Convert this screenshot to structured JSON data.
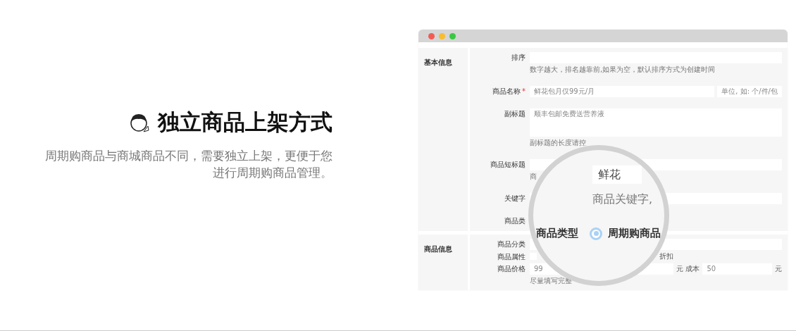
{
  "headline": {
    "title": "独立商品上架方式",
    "description_lines": [
      "周期购商品与商城商品不同，需要独立上架，更便于您",
      "进行周期购商品管理。"
    ]
  },
  "form": {
    "sections": [
      {
        "title": "基本信息",
        "rows": [
          {
            "kind": "input",
            "label": "排序",
            "hint": "数字越大，排名越靠前,如果为空，默认排序方式为创建时间"
          },
          {
            "kind": "input",
            "label": "商品名称",
            "required_mark": "*",
            "placeholder": "鲜花包月仅99元/月",
            "unit_placeholder": "单位, 如: 个/件/包"
          },
          {
            "kind": "textarea",
            "label": "副标题",
            "placeholder": "顺丰包邮免费送营养液",
            "hint": "副标题的长度请控"
          },
          {
            "kind": "input",
            "label": "商品短标题",
            "hint": "商"
          },
          {
            "kind": "input",
            "label": "关键字"
          },
          {
            "kind": "plain",
            "label": "商品类"
          }
        ]
      },
      {
        "title": "商品信息",
        "rows": [
          {
            "kind": "input",
            "label": "商品分类"
          },
          {
            "kind": "checkbox",
            "label": "商品属性",
            "checked": false,
            "trailing": "折扣"
          },
          {
            "kind": "price",
            "label": "商品价格",
            "price": "99",
            "price_unit": "元 成本",
            "cost": "50",
            "cost_unit": "元",
            "hint": "尽量填写完整"
          }
        ]
      }
    ]
  },
  "magnifier": {
    "field_value": "鲜花",
    "hint": "商品关键字,",
    "label": "商品类型",
    "option": {
      "label": "周期购商品",
      "selected": true
    }
  }
}
